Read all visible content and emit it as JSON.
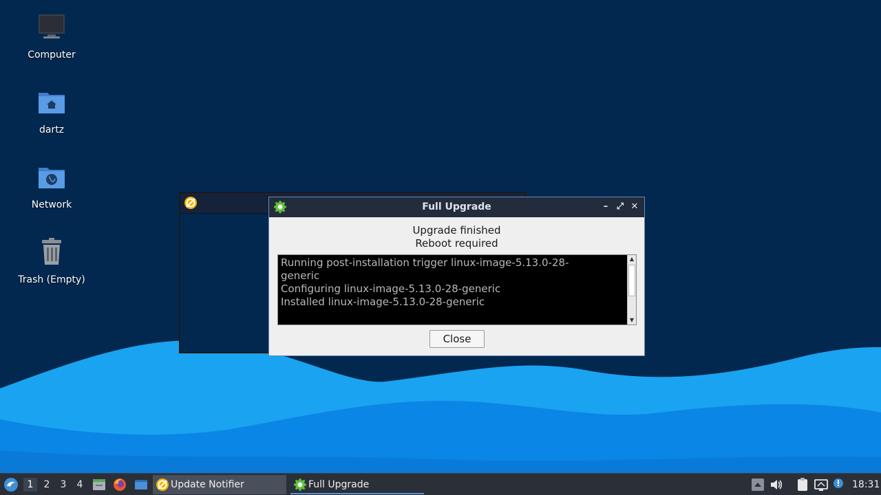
{
  "desktop": {
    "icons": [
      {
        "label": "Computer",
        "icon": "computer-icon"
      },
      {
        "label": "dartz",
        "icon": "home-folder-icon"
      },
      {
        "label": "Network",
        "icon": "network-folder-icon"
      },
      {
        "label": "Trash (Empty)",
        "icon": "trash-icon"
      }
    ]
  },
  "dialog": {
    "title": "Full Upgrade",
    "message_line1": "Upgrade finished",
    "message_line2": "Reboot required",
    "log_lines": [
      "Running post-installation trigger linux-image-5.13.0-28-",
      "generic",
      "Configuring linux-image-5.13.0-28-generic",
      "Installed linux-image-5.13.0-28-generic"
    ],
    "close_label": "Close"
  },
  "taskbar": {
    "workspaces": [
      "1",
      "2",
      "3",
      "4"
    ],
    "active_workspace": "1",
    "tasks": [
      {
        "label": "Update Notifier",
        "icon": "update-notifier-icon"
      },
      {
        "label": "Full Upgrade",
        "icon": "gear-icon"
      }
    ],
    "clock": "18:31"
  },
  "colors": {
    "desktop_bg": "#03284f",
    "wave_light": "#1aa3f0",
    "wave_dark": "#0a7fe0",
    "titlebar": "#222c3d",
    "taskbar": "#2a2f38"
  }
}
